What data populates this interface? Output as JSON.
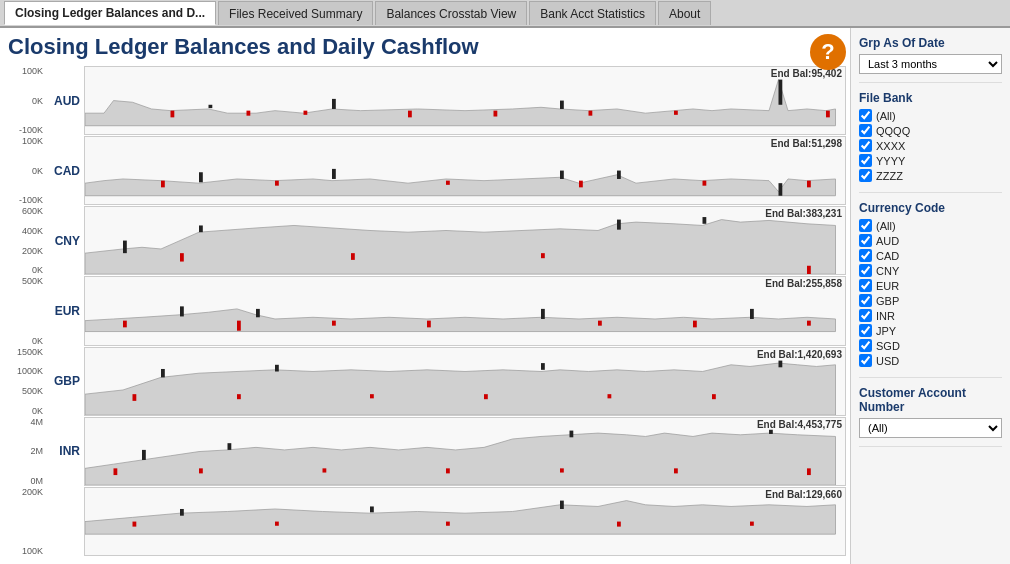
{
  "tabs": [
    {
      "label": "Closing Ledger Balances and D...",
      "active": true
    },
    {
      "label": "Files Received Summary",
      "active": false
    },
    {
      "label": "Balances Crosstab View",
      "active": false
    },
    {
      "label": "Bank Acct Statistics",
      "active": false
    },
    {
      "label": "About",
      "active": false
    }
  ],
  "page_title": "Closing Ledger Balances and Daily Cashflow",
  "help_icon": "?",
  "charts": [
    {
      "currency": "AUD",
      "y_labels": [
        "100K",
        "0K",
        "-100K"
      ],
      "end_bal": "End Bal:95,402",
      "area_color": "#c8c8c8",
      "zero_pct": 60
    },
    {
      "currency": "CAD",
      "y_labels": [
        "100K",
        "0K",
        "-100K"
      ],
      "end_bal": "End Bal:51,298",
      "area_color": "#c8c8c8",
      "zero_pct": 60
    },
    {
      "currency": "CNY",
      "y_labels": [
        "600K",
        "400K",
        "200K",
        "0K"
      ],
      "end_bal": "End Bal:383,231",
      "area_color": "#c8c8c8",
      "zero_pct": 90
    },
    {
      "currency": "EUR",
      "y_labels": [
        "500K",
        "0K"
      ],
      "end_bal": "End Bal:255,858",
      "area_color": "#c8c8c8",
      "zero_pct": 55
    },
    {
      "currency": "GBP",
      "y_labels": [
        "1500K",
        "1000K",
        "500K",
        "0K"
      ],
      "end_bal": "End Bal:1,420,693",
      "area_color": "#c8c8c8",
      "zero_pct": 90
    },
    {
      "currency": "INR",
      "y_labels": [
        "4M",
        "2M",
        "0M"
      ],
      "end_bal": "End Bal:4,453,775",
      "area_color": "#c8c8c8",
      "zero_pct": 85
    },
    {
      "currency": "",
      "y_labels": [
        "200K",
        "100K"
      ],
      "end_bal": "End Bal:129,660",
      "area_color": "#c8c8c8",
      "zero_pct": 50
    }
  ],
  "sidebar": {
    "grp_as_of_date_title": "Grp As Of Date",
    "grp_as_of_date_value": "Last 3 months",
    "file_bank_title": "File Bank",
    "file_bank_items": [
      {
        "label": "(All)",
        "checked": true
      },
      {
        "label": "QQQQ",
        "checked": true
      },
      {
        "label": "XXXX",
        "checked": true
      },
      {
        "label": "YYYY",
        "checked": true
      },
      {
        "label": "ZZZZ",
        "checked": true
      }
    ],
    "currency_code_title": "Currency Code",
    "currency_code_items": [
      {
        "label": "(All)",
        "checked": true
      },
      {
        "label": "AUD",
        "checked": true
      },
      {
        "label": "CAD",
        "checked": true
      },
      {
        "label": "CNY",
        "checked": true
      },
      {
        "label": "EUR",
        "checked": true
      },
      {
        "label": "GBP",
        "checked": true
      },
      {
        "label": "INR",
        "checked": true
      },
      {
        "label": "JPY",
        "checked": true
      },
      {
        "label": "SGD",
        "checked": true
      },
      {
        "label": "USD",
        "checked": true
      }
    ],
    "customer_acct_title": "Customer Account Number",
    "customer_acct_value": "(All)"
  }
}
